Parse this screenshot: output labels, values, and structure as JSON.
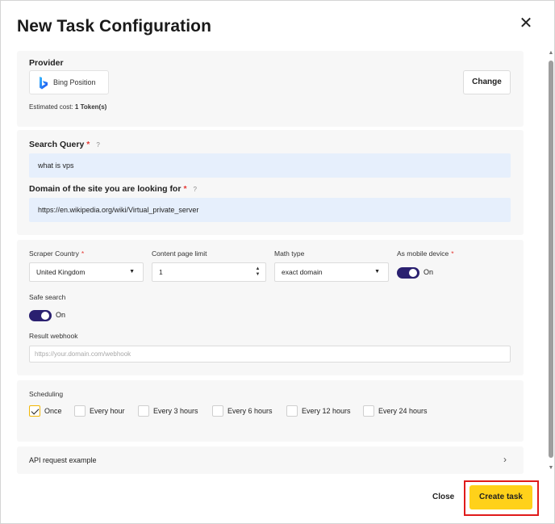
{
  "dialog": {
    "title": "New Task Configuration",
    "close_icon": "close-icon"
  },
  "provider": {
    "label": "Provider",
    "name": "Bing Position",
    "icon": "bing-logo-icon",
    "change_label": "Change",
    "cost_prefix": "Estimated cost:",
    "cost_value": "1 Token(s)"
  },
  "search_query": {
    "label": "Search Query",
    "required": "*",
    "help": "?",
    "value": "what is vps"
  },
  "domain": {
    "label": "Domain of the site you are looking for",
    "required": "*",
    "help": "?",
    "value": "https://en.wikipedia.org/wiki/Virtual_private_server"
  },
  "options": {
    "scraper_country": {
      "label": "Scraper Country",
      "required": "*",
      "value": "United Kingdom"
    },
    "content_page_limit": {
      "label": "Content page limit",
      "value": "1"
    },
    "math_type": {
      "label": "Math type",
      "value": "exact domain"
    },
    "as_mobile_device": {
      "label": "As mobile device",
      "required": "*",
      "toggle_text": "On",
      "enabled": true
    },
    "safe_search": {
      "label": "Safe search",
      "toggle_text": "On",
      "enabled": true
    },
    "result_webhook": {
      "label": "Result webhook",
      "placeholder": "https://your.domain.com/webhook"
    }
  },
  "scheduling": {
    "label": "Scheduling",
    "options": [
      {
        "label": "Once",
        "checked": true
      },
      {
        "label": "Every hour",
        "checked": false
      },
      {
        "label": "Every 3 hours",
        "checked": false
      },
      {
        "label": "Every 6 hours",
        "checked": false
      },
      {
        "label": "Every 12 hours",
        "checked": false
      },
      {
        "label": "Every 24 hours",
        "checked": false
      }
    ]
  },
  "api_example": {
    "label": "API request example",
    "chevron": "›"
  },
  "footer": {
    "close_label": "Close",
    "create_label": "Create task"
  },
  "colors": {
    "accent_yellow": "#ffd11a",
    "toggle_purple": "#2a2070",
    "highlight_red": "#e01b1b",
    "input_blue": "#e6effc"
  }
}
